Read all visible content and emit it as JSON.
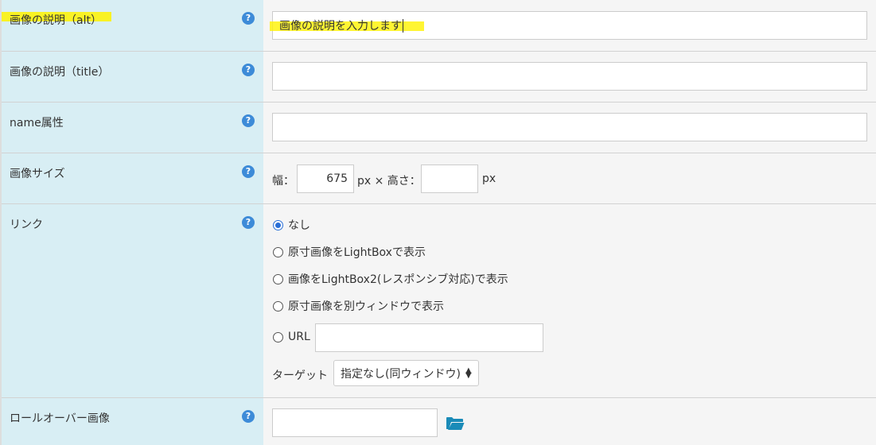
{
  "help_glyph": "?",
  "rows": {
    "alt": {
      "label": "画像の説明（alt）",
      "value": "画像の説明を入力します",
      "placeholder": ""
    },
    "title": {
      "label": "画像の説明（title）",
      "value": "",
      "placeholder": ""
    },
    "name": {
      "label": "name属性",
      "value": "",
      "placeholder": ""
    },
    "size": {
      "label": "画像サイズ",
      "width_label": "幅：",
      "width_value": "675",
      "px_times": "px × 高さ：",
      "height_value": "",
      "px_unit": "px"
    },
    "link": {
      "label": "リンク",
      "options": [
        {
          "label": "なし",
          "checked": true
        },
        {
          "label": "原寸画像をLightBoxで表示",
          "checked": false
        },
        {
          "label": "画像をLightBox2(レスポンシブ対応)で表示",
          "checked": false
        },
        {
          "label": "原寸画像を別ウィンドウで表示",
          "checked": false
        },
        {
          "label": "URL",
          "checked": false
        }
      ],
      "url_value": "",
      "target_label": "ターゲット",
      "target_selected": "指定なし(同ウィンドウ)"
    },
    "rollover": {
      "label": "ロールオーバー画像",
      "value": "",
      "folder_icon": "folder-open-icon"
    }
  },
  "colors": {
    "label_bg": "#d8eef4",
    "value_bg": "#f5f5f5",
    "help_icon": "#3d8bd8",
    "highlight": "#fff200",
    "folder_icon": "#1a8bb8",
    "radio_checked": "#2a6fd6"
  }
}
